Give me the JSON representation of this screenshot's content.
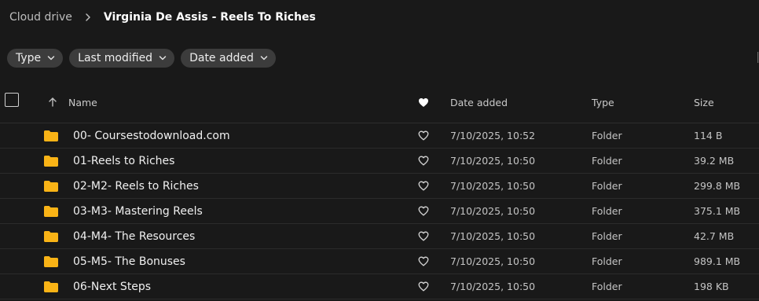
{
  "breadcrumb": {
    "root": "Cloud drive",
    "current": "Virginia De Assis - Reels To Riches"
  },
  "filters": [
    {
      "label": "Type"
    },
    {
      "label": "Last modified"
    },
    {
      "label": "Date added"
    }
  ],
  "table": {
    "columns": {
      "name": "Name",
      "date_added": "Date added",
      "type": "Type",
      "size": "Size"
    },
    "rows": [
      {
        "name": "00- Coursestodownload.com",
        "date": "7/10/2025, 10:52",
        "type": "Folder",
        "size": "114 B"
      },
      {
        "name": "01-Reels to Riches",
        "date": "7/10/2025, 10:50",
        "type": "Folder",
        "size": "39.2 MB"
      },
      {
        "name": "02-M2- Reels to Riches",
        "date": "7/10/2025, 10:50",
        "type": "Folder",
        "size": "299.8 MB"
      },
      {
        "name": "03-M3- Mastering Reels",
        "date": "7/10/2025, 10:50",
        "type": "Folder",
        "size": "375.1 MB"
      },
      {
        "name": "04-M4- The Resources",
        "date": "7/10/2025, 10:50",
        "type": "Folder",
        "size": "42.7 MB"
      },
      {
        "name": "05-M5- The Bonuses",
        "date": "7/10/2025, 10:50",
        "type": "Folder",
        "size": "989.1 MB"
      },
      {
        "name": "06-Next Steps",
        "date": "7/10/2025, 10:50",
        "type": "Folder",
        "size": "198 KB"
      }
    ]
  },
  "colors": {
    "background": "#191919",
    "chip": "#3c3c3c",
    "folder": "#f9b316",
    "text": "#f0f0f0"
  }
}
